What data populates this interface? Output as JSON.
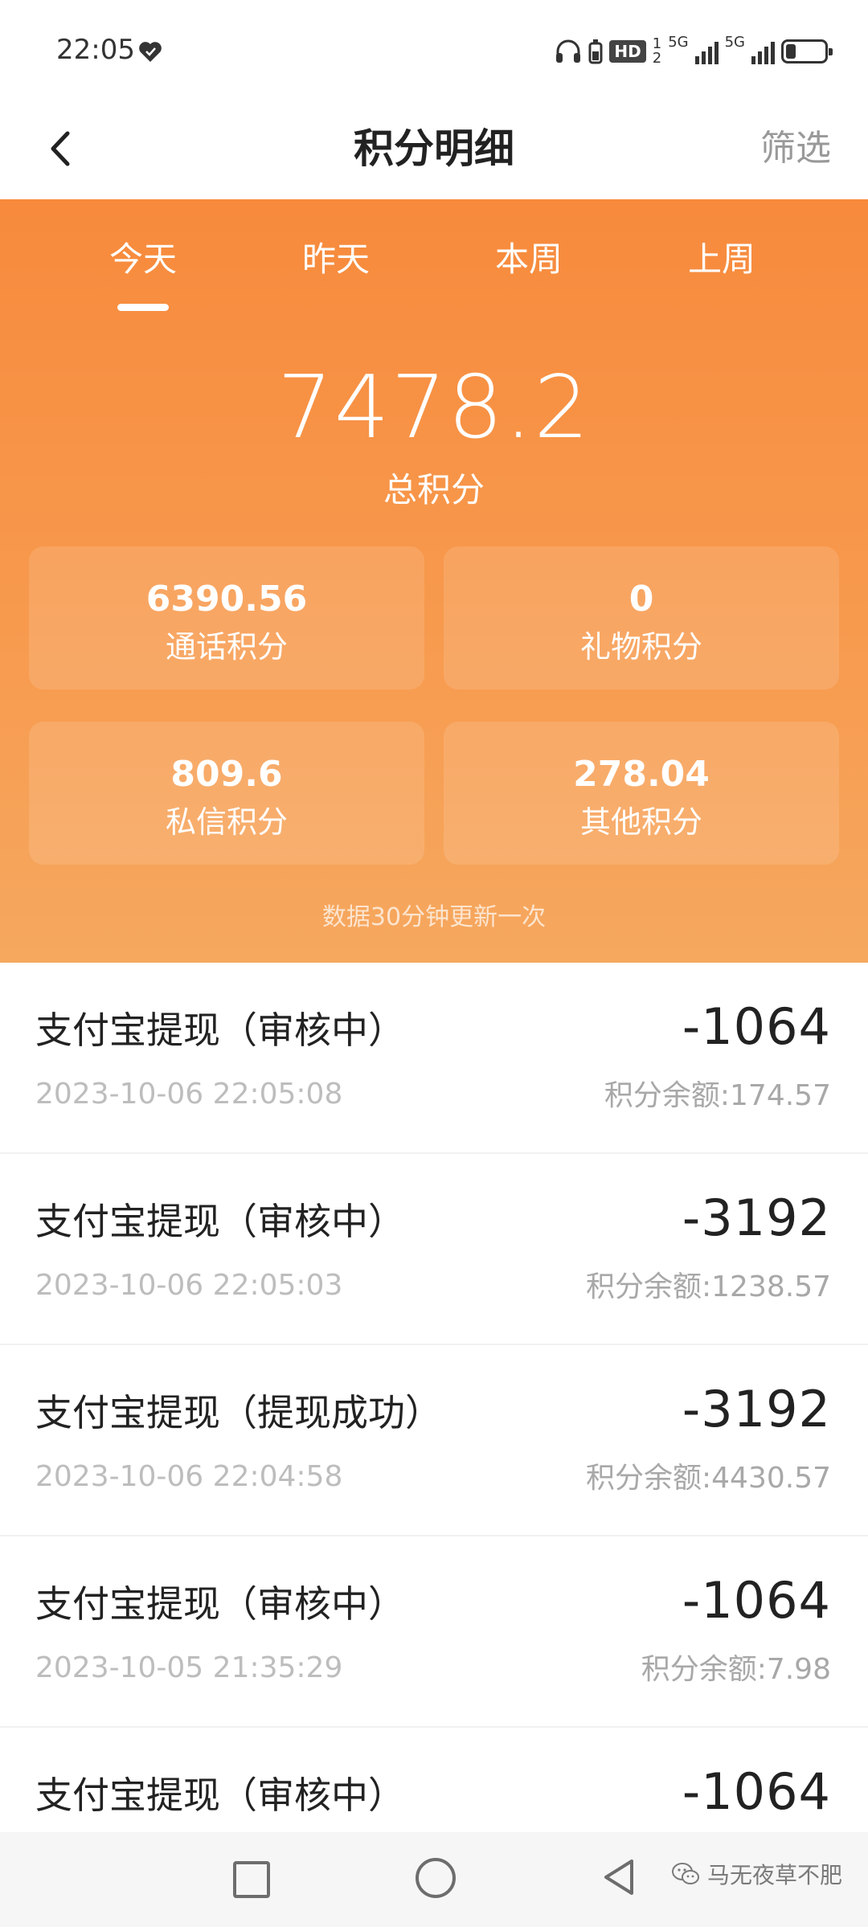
{
  "status_bar": {
    "time": "22:05",
    "hd": "HD",
    "sim1": "5G",
    "sim2": "5G",
    "sim_index_1": "1",
    "sim_index_2": "2",
    "battery_level": 0.25
  },
  "header": {
    "title": "积分明细",
    "filter": "筛选"
  },
  "tabs": [
    {
      "label": "今天",
      "active": true
    },
    {
      "label": "昨天",
      "active": false
    },
    {
      "label": "本周",
      "active": false
    },
    {
      "label": "上周",
      "active": false
    }
  ],
  "summary": {
    "total_value": "7478.2",
    "total_label": "总积分",
    "cards": [
      {
        "value": "6390.56",
        "label": "通话积分"
      },
      {
        "value": "0",
        "label": "礼物积分"
      },
      {
        "value": "809.6",
        "label": "私信积分"
      },
      {
        "value": "278.04",
        "label": "其他积分"
      }
    ],
    "update_note": "数据30分钟更新一次"
  },
  "records": [
    {
      "title": "支付宝提现（审核中）",
      "amount": "-1064",
      "time": "2023-10-06 22:05:08",
      "balance": "积分余额:174.57"
    },
    {
      "title": "支付宝提现（审核中）",
      "amount": "-3192",
      "time": "2023-10-06 22:05:03",
      "balance": "积分余额:1238.57"
    },
    {
      "title": "支付宝提现（提现成功）",
      "amount": "-3192",
      "time": "2023-10-06 22:04:58",
      "balance": "积分余额:4430.57"
    },
    {
      "title": "支付宝提现（审核中）",
      "amount": "-1064",
      "time": "2023-10-05 21:35:29",
      "balance": "积分余额:7.98"
    },
    {
      "title": "支付宝提现（审核中）",
      "amount": "-1064",
      "time": "",
      "balance": ""
    }
  ],
  "watermark": "马无夜草不肥",
  "colors": {
    "accent_orange": "#f78a3c",
    "text_dark": "#222222",
    "text_grey": "#bdbdbd"
  }
}
